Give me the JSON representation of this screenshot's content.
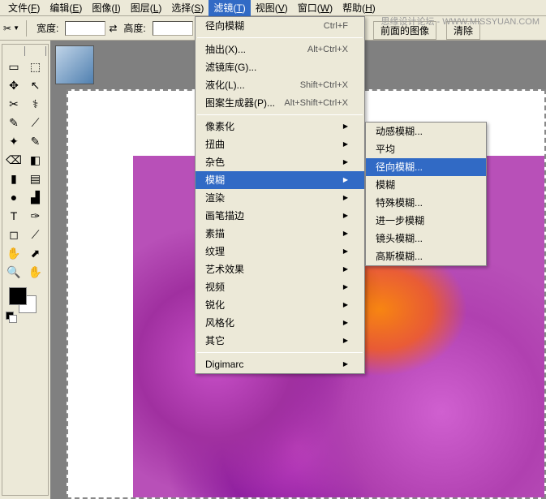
{
  "menubar": {
    "items": [
      {
        "label": "文件",
        "key": "F"
      },
      {
        "label": "编辑",
        "key": "E"
      },
      {
        "label": "图像",
        "key": "I"
      },
      {
        "label": "图层",
        "key": "L"
      },
      {
        "label": "选择",
        "key": "S"
      },
      {
        "label": "滤镜",
        "key": "T"
      },
      {
        "label": "视图",
        "key": "V"
      },
      {
        "label": "窗口",
        "key": "W"
      },
      {
        "label": "帮助",
        "key": "H"
      }
    ]
  },
  "toolbar": {
    "width_label": "宽度:",
    "height_label": "高度:",
    "front_image": "前面的图像",
    "clear": "清除"
  },
  "watermark": "思缘设计论坛 - WWW.MISSYUAN.COM",
  "filter_menu": {
    "items": [
      {
        "label": "径向模糊",
        "shortcut": "Ctrl+F"
      },
      {
        "sep": true
      },
      {
        "label": "抽出(X)...",
        "shortcut": "Alt+Ctrl+X"
      },
      {
        "label": "滤镜库(G)..."
      },
      {
        "label": "液化(L)...",
        "shortcut": "Shift+Ctrl+X"
      },
      {
        "label": "图案生成器(P)...",
        "shortcut": "Alt+Shift+Ctrl+X"
      },
      {
        "sep": true
      },
      {
        "label": "像素化",
        "sub": true
      },
      {
        "label": "扭曲",
        "sub": true
      },
      {
        "label": "杂色",
        "sub": true
      },
      {
        "label": "模糊",
        "sub": true,
        "hl": true
      },
      {
        "label": "渲染",
        "sub": true
      },
      {
        "label": "画笔描边",
        "sub": true
      },
      {
        "label": "素描",
        "sub": true
      },
      {
        "label": "纹理",
        "sub": true
      },
      {
        "label": "艺术效果",
        "sub": true
      },
      {
        "label": "视频",
        "sub": true
      },
      {
        "label": "锐化",
        "sub": true
      },
      {
        "label": "风格化",
        "sub": true
      },
      {
        "label": "其它",
        "sub": true
      },
      {
        "sep": true
      },
      {
        "label": "Digimarc",
        "sub": true
      }
    ]
  },
  "blur_menu": {
    "items": [
      {
        "label": "动感模糊..."
      },
      {
        "label": "平均"
      },
      {
        "label": "径向模糊...",
        "hl": true
      },
      {
        "label": "模糊"
      },
      {
        "label": "特殊模糊..."
      },
      {
        "label": "进一步模糊"
      },
      {
        "label": "镜头模糊..."
      },
      {
        "label": "高斯模糊..."
      }
    ]
  },
  "tools": {
    "glyphs": [
      "▭",
      "⬚",
      "✥",
      "↖",
      "✂",
      "⚕",
      "✎",
      "⟋",
      "✦",
      "✎",
      "⌫",
      "◧",
      "▮",
      "▤",
      "●",
      "▟",
      "T",
      "✑",
      "◻",
      "⟋",
      "✋",
      "⬈",
      "🔍",
      "✋"
    ]
  }
}
